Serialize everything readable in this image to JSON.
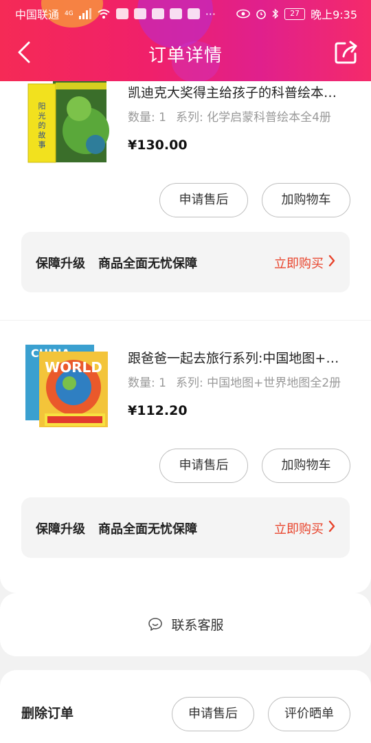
{
  "status_bar": {
    "carrier": "中国联通",
    "network": "4G",
    "battery": "27",
    "time": "晚上9:35"
  },
  "header": {
    "title": "订单详情"
  },
  "products": [
    {
      "name": "凯迪克大奖得主给孩子的科普绘本系列",
      "quantity_label": "数量: 1",
      "series_label": "系列: 化学启蒙科普绘本全4册",
      "price": "¥130.00",
      "cover_text": "阳光的故事"
    },
    {
      "name": "跟爸爸一起去旅行系列:中国地图+世界地图",
      "quantity_label": "数量: 1",
      "series_label": "系列: 中国地图+世界地图全2册",
      "price": "¥112.20",
      "cover_text": "WORLD"
    }
  ],
  "actions": {
    "after_sale": "申请售后",
    "add_cart": "加购物车"
  },
  "guarantee": {
    "title": "保障升级",
    "subtitle": "商品全面无忧保障",
    "buy": "立即购买"
  },
  "service": {
    "label": "联系客服"
  },
  "bottom": {
    "delete": "删除订单",
    "after_sale": "申请售后",
    "review": "评价晒单"
  },
  "colors": {
    "accent": "#e8432b",
    "header_start": "#f52a56",
    "header_end": "#e0208c"
  }
}
